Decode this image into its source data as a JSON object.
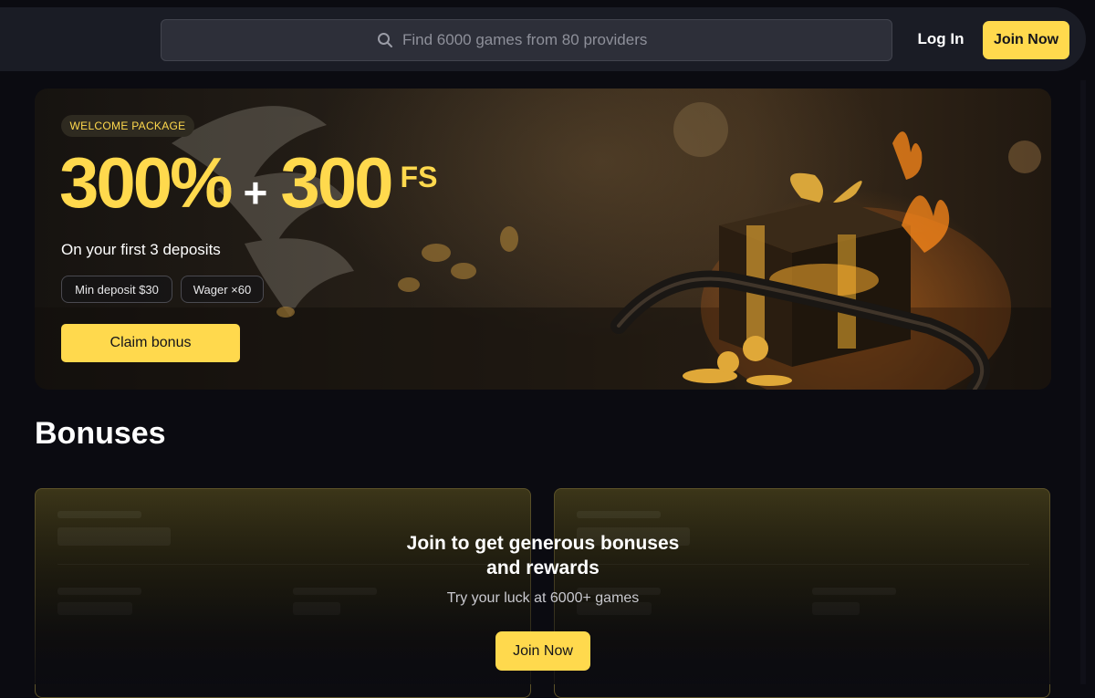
{
  "header": {
    "search_placeholder": "Find 6000 games from 80 providers",
    "login_label": "Log In",
    "join_label": "Join Now"
  },
  "hero": {
    "badge": "WELCOME PACKAGE",
    "percent": "300%",
    "plus": "+",
    "spins": "300",
    "spins_unit": "FS",
    "subtitle": "On your first 3 deposits",
    "pills": [
      "Min deposit $30",
      "Wager ×60"
    ],
    "claim_label": "Claim bonus"
  },
  "bonuses": {
    "title": "Bonuses",
    "cta_title_line1": "Join to get generous bonuses",
    "cta_title_line2": "and rewards",
    "cta_subtitle": "Try your luck at 6000+ games",
    "join_label": "Join Now"
  },
  "colors": {
    "accent": "#ffd94d",
    "background": "#0b0b11",
    "header": "#1a1c25"
  }
}
